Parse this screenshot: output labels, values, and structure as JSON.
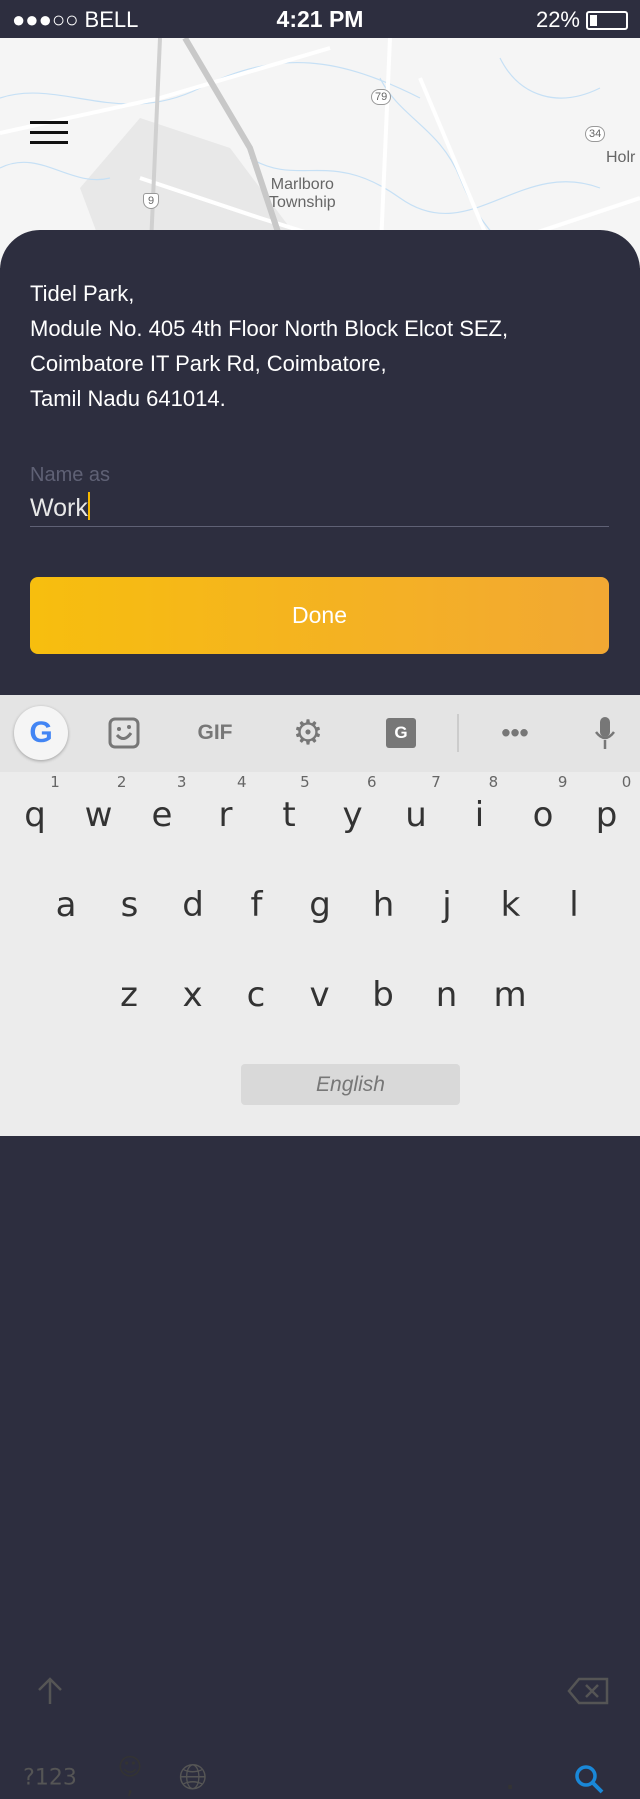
{
  "status": {
    "carrier": "●●●○○ BELL",
    "time": "4:21 PM",
    "battery": "22%",
    "battery_level": 0.22
  },
  "map": {
    "labels": [
      "Marlboro",
      "Township",
      "Holr"
    ],
    "shields": [
      "79",
      "34",
      "9"
    ]
  },
  "address": {
    "title": "Tidel Park,",
    "lines": [
      "Module No. 405 4th Floor North Block Elcot SEZ,",
      "Coimbatore IT Park Rd, Coimbatore,",
      "Tamil Nadu 641014."
    ]
  },
  "name_field": {
    "label": "Name as",
    "value": "Work"
  },
  "done_label": "Done",
  "keyboard": {
    "toolbar": [
      "google-icon",
      "sticker-icon",
      "GIF",
      "gear-icon",
      "translate-icon",
      "more-icon",
      "mic-icon"
    ],
    "row1": [
      {
        "k": "q",
        "n": "1"
      },
      {
        "k": "w",
        "n": "2"
      },
      {
        "k": "e",
        "n": "3"
      },
      {
        "k": "r",
        "n": "4"
      },
      {
        "k": "t",
        "n": "5"
      },
      {
        "k": "y",
        "n": "6"
      },
      {
        "k": "u",
        "n": "7"
      },
      {
        "k": "i",
        "n": "8"
      },
      {
        "k": "o",
        "n": "9"
      },
      {
        "k": "p",
        "n": "0"
      }
    ],
    "row2": [
      "a",
      "s",
      "d",
      "f",
      "g",
      "h",
      "j",
      "k",
      "l"
    ],
    "row3": [
      "z",
      "x",
      "c",
      "v",
      "b",
      "n",
      "m"
    ],
    "symbols": "?123",
    "emoji": "☺",
    "comma": ",",
    "space": "English",
    "period": "."
  }
}
